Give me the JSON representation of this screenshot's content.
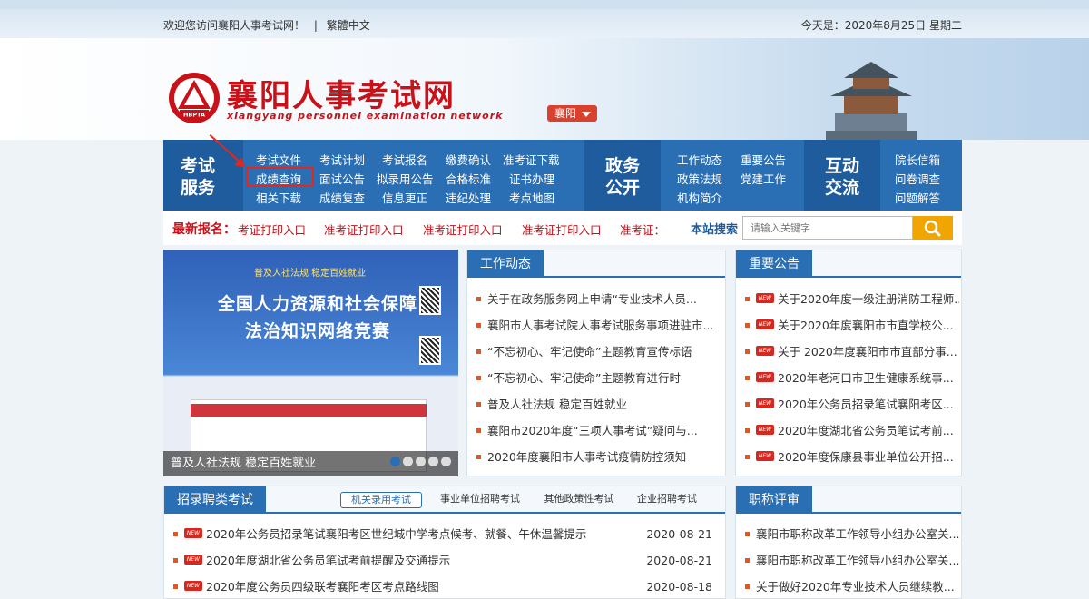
{
  "topbar": {
    "welcome": "欢迎您访问襄阳人事考试网！",
    "lang": "繁體中文",
    "date": "今天是：2020年8月25日 星期二"
  },
  "logo": {
    "title": "襄阳人事考试网",
    "subtitle": "xiangyang personnel examination network",
    "seal_text": "HBPTA",
    "city": "襄阳"
  },
  "nav": {
    "exam_service": "考试服务",
    "exam_links": [
      [
        "考试文件",
        "考试计划",
        "考试报名",
        "缴费确认",
        "准考证下载"
      ],
      [
        "成绩查询",
        "面试公告",
        "拟录用公告",
        "合格标准",
        "证书办理"
      ],
      [
        "相关下载",
        "成绩复查",
        "信息更正",
        "违纪处理",
        "考点地图"
      ]
    ],
    "gov_open": "政务公开",
    "gov_links": [
      [
        "工作动态",
        "重要公告"
      ],
      [
        "政策法规",
        "党建工作"
      ],
      [
        "机构简介"
      ]
    ],
    "interaction": "互动交流",
    "interaction_links": [
      "院长信箱",
      "问卷调查",
      "问题解答"
    ]
  },
  "latest": {
    "label": "最新报名：",
    "items": [
      "考证打印入口",
      "准考证打印入口",
      "准考证打印入口",
      "准考证打印入口",
      "准考证："
    ]
  },
  "search": {
    "label": "本站搜索",
    "placeholder": "请输入关键字"
  },
  "slider": {
    "poster_top": "普及人社法规  稳定百姓就业",
    "poster_title1": "全国人力资源和社会保障",
    "poster_title2": "法治知识网络竞赛",
    "caption": "普及人社法规 稳定百姓就业",
    "active_index": 0,
    "count": 5
  },
  "work_news": {
    "title": "工作动态",
    "items": [
      "关于在政务服务网上申请“专业技术人员...",
      "襄阳市人事考试院人事考试服务事项进驻市...",
      "“不忘初心、牢记使命”主题教育宣传标语",
      "“不忘初心、牢记使命”主题教育进行时",
      "普及人社法规 稳定百姓就业",
      "襄阳市2020年度“三项人事考试”疑问与...",
      "2020年度襄阳市人事考试疫情防控须知"
    ]
  },
  "notices": {
    "title": "重要公告",
    "badge": "NEW",
    "items": [
      "关于2020年度一级注册消防工程师...",
      "关于2020年度襄阳市市直学校公...",
      "关于 2020年度襄阳市市直部分事...",
      "2020年老河口市卫生健康系统事...",
      "2020年公务员招录笔试襄阳考区...",
      "2020年度湖北省公务员笔试考前...",
      "2020年度保康县事业单位公开招..."
    ]
  },
  "recruit": {
    "title": "招录聘类考试",
    "tabs": [
      "机关录用考试",
      "事业单位招聘考试",
      "其他政策性考试",
      "企业招聘考试"
    ],
    "active_tab": 0,
    "badge": "NEW",
    "items": [
      {
        "text": "2020年公务员招录笔试襄阳考区世纪城中学考点候考、就餐、午休温馨提示",
        "date": "2020-08-21"
      },
      {
        "text": "2020年度湖北省公务员笔试考前提醒及交通提示",
        "date": "2020-08-21"
      },
      {
        "text": "2020年度公务员四级联考襄阳考区考点路线图",
        "date": "2020-08-18"
      }
    ]
  },
  "title_review": {
    "title": "职称评审",
    "items": [
      "襄阳市职称改革工作领导小组办公室关...",
      "襄阳市职称改革工作领导小组办公室关...",
      "关于做好2020年专业技术人员继续教..."
    ]
  },
  "colors": {
    "brand_red": "#c8121a",
    "nav_blue": "#2a6eb3",
    "search_orange": "#f0a500"
  }
}
